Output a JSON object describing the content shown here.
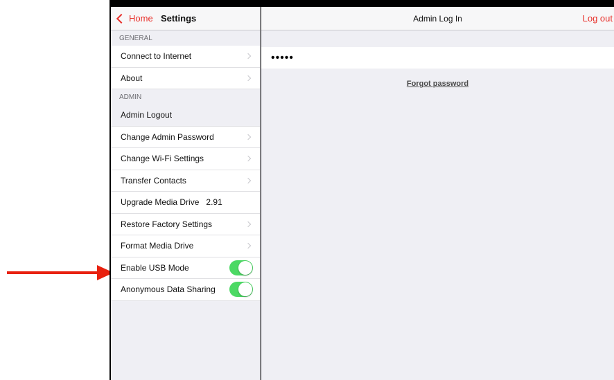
{
  "sidebar": {
    "home_label": "Home",
    "title": "Settings",
    "general_header": "GENERAL",
    "general_items": [
      {
        "label": "Connect to Internet"
      },
      {
        "label": "About"
      }
    ],
    "admin_header": "ADMIN",
    "admin_items": [
      {
        "label": "Admin Logout"
      },
      {
        "label": "Change Admin Password"
      },
      {
        "label": "Change Wi-Fi Settings"
      },
      {
        "label": "Transfer Contacts"
      },
      {
        "label": "Upgrade Media Drive",
        "value": "2.91"
      },
      {
        "label": "Restore Factory Settings"
      },
      {
        "label": "Format Media Drive"
      },
      {
        "label": "Enable USB Mode",
        "toggle": "on"
      },
      {
        "label": "Anonymous Data Sharing",
        "toggle": "on"
      }
    ]
  },
  "main": {
    "title": "Admin Log In",
    "logout_label": "Log out",
    "password_value": "•••••",
    "forgot_label": "Forgot password"
  },
  "colors": {
    "accent": "#e8302a",
    "toggle_on": "#4cd964",
    "annotation_arrow": "#e8210f"
  }
}
